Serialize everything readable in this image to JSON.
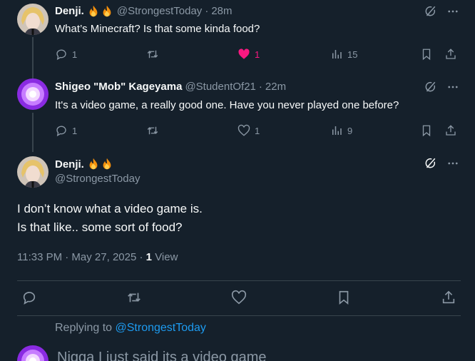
{
  "thread": [
    {
      "display_name": "Denji.",
      "emoji": [
        "fire",
        "fire"
      ],
      "handle": "@StrongestToday",
      "time": "28m",
      "text": "What’s Minecraft? Is that some kinda food?",
      "stats": {
        "replies": "1",
        "likes": "1",
        "views": "15"
      },
      "liked": true
    },
    {
      "display_name": "Shigeo \"Mob\" Kageyama",
      "handle": "@StudentOf21",
      "time": "22m",
      "text": "It's a video game, a really good one. Have you never played one before?",
      "stats": {
        "replies": "1",
        "likes": "1",
        "views": "9"
      },
      "liked": false
    }
  ],
  "main": {
    "display_name": "Denji.",
    "emoji": [
      "fire",
      "fire"
    ],
    "handle": "@StrongestToday",
    "text_line1": "I don’t know what a video game is.",
    "text_line2": "Is that like.. some sort of food?",
    "timestamp": "11:33 PM · May 27, 2025",
    "view_count": "1",
    "view_label": "View"
  },
  "compose": {
    "replying_to_label": "Replying to",
    "replying_to_handle": "@StrongestToday",
    "draft_text": "Nigga I just said its a video game"
  },
  "colors": {
    "background": "#15202b",
    "text": "#f7f9f9",
    "muted": "#8b98a5",
    "border": "#38444d",
    "like": "#f91880",
    "link": "#1d9bf0"
  },
  "icons": [
    "grok-icon",
    "more-icon",
    "reply-icon",
    "retweet-icon",
    "heart-icon",
    "views-icon",
    "bookmark-icon",
    "share-icon",
    "fire-emoji"
  ]
}
